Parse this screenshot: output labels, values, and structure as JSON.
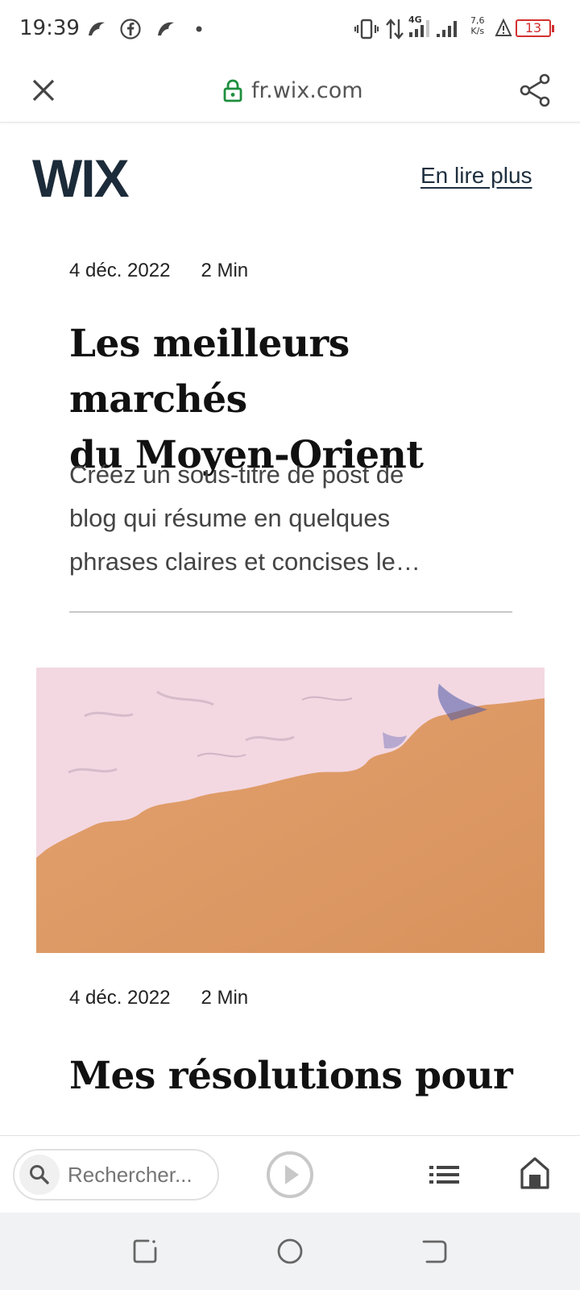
{
  "status_bar": {
    "time": "19:39",
    "network_type": "4G",
    "speed_value": "7,6",
    "speed_unit": "K/s",
    "battery": "13"
  },
  "browser": {
    "url": "fr.wix.com"
  },
  "header": {
    "logo_text": "WIX",
    "read_more": "En lire plus"
  },
  "posts": [
    {
      "date": "4 déc. 2022",
      "read_time": "2 Min",
      "title_line1": "Les meilleurs marchés",
      "title_line2": "du Moyen-Orient",
      "excerpt_line1": "Créez un sous-titre de post de",
      "excerpt_line2": "blog qui résume en quelques",
      "excerpt_line3": "phrases claires et concises le…"
    },
    {
      "date": "4 déc. 2022",
      "read_time": "2 Min",
      "title_line1": "Mes résolutions pour"
    }
  ],
  "toolbar": {
    "search_placeholder": "Rechercher..."
  },
  "colors": {
    "lock_green": "#1e8e3e",
    "logo_navy": "#1c2b39",
    "sand": "#dd9a66",
    "foam": "#f3d8e2",
    "battery_red": "#d32f2f"
  }
}
